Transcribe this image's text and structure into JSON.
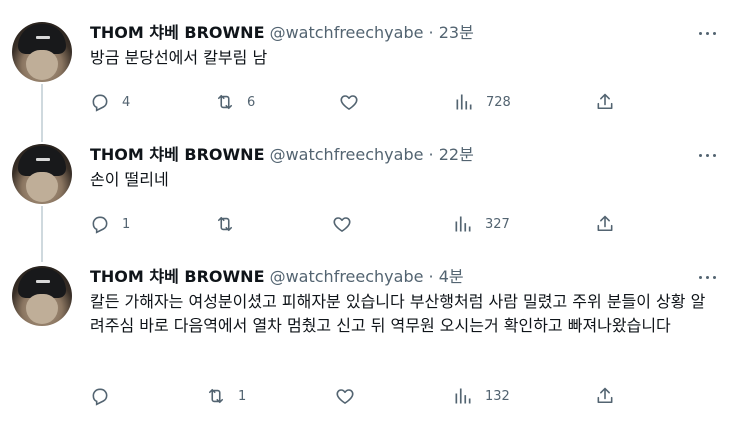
{
  "tweets": [
    {
      "name": "THOM 챠베 BROWNE",
      "handle": "@watchfreechyabe",
      "dot": "·",
      "time": "23분",
      "text": "방금 분당선에서 칼부림 남",
      "replies": "4",
      "retweets": "6",
      "likes": "",
      "views": "728"
    },
    {
      "name": "THOM 챠베 BROWNE",
      "handle": "@watchfreechyabe",
      "dot": "·",
      "time": "22분",
      "text": "손이 떨리네",
      "replies": "1",
      "retweets": "",
      "likes": "",
      "views": "327"
    },
    {
      "name": "THOM 챠베 BROWNE",
      "handle": "@watchfreechyabe",
      "dot": "·",
      "time": "4분",
      "text": "칼든 가해자는 여성분이셨고 피해자분 있습니다 부산행처럼 사람 밀렸고 주위 분들이 상황 알려주심 바로 다음역에서 열차 멈췄고 신고 뒤 역무원 오시는거 확인하고 빠져나왔습니다",
      "replies": "",
      "retweets": "1",
      "likes": "",
      "views": "132"
    }
  ],
  "icons": {
    "reply": "reply-icon",
    "retweet": "retweet-icon",
    "like": "heart-icon",
    "views": "views-chart-icon",
    "share": "share-icon",
    "more": "more-dots-icon"
  },
  "colors": {
    "text": "#0f1419",
    "secondary": "#536471",
    "thread_line": "#cfd9de"
  }
}
